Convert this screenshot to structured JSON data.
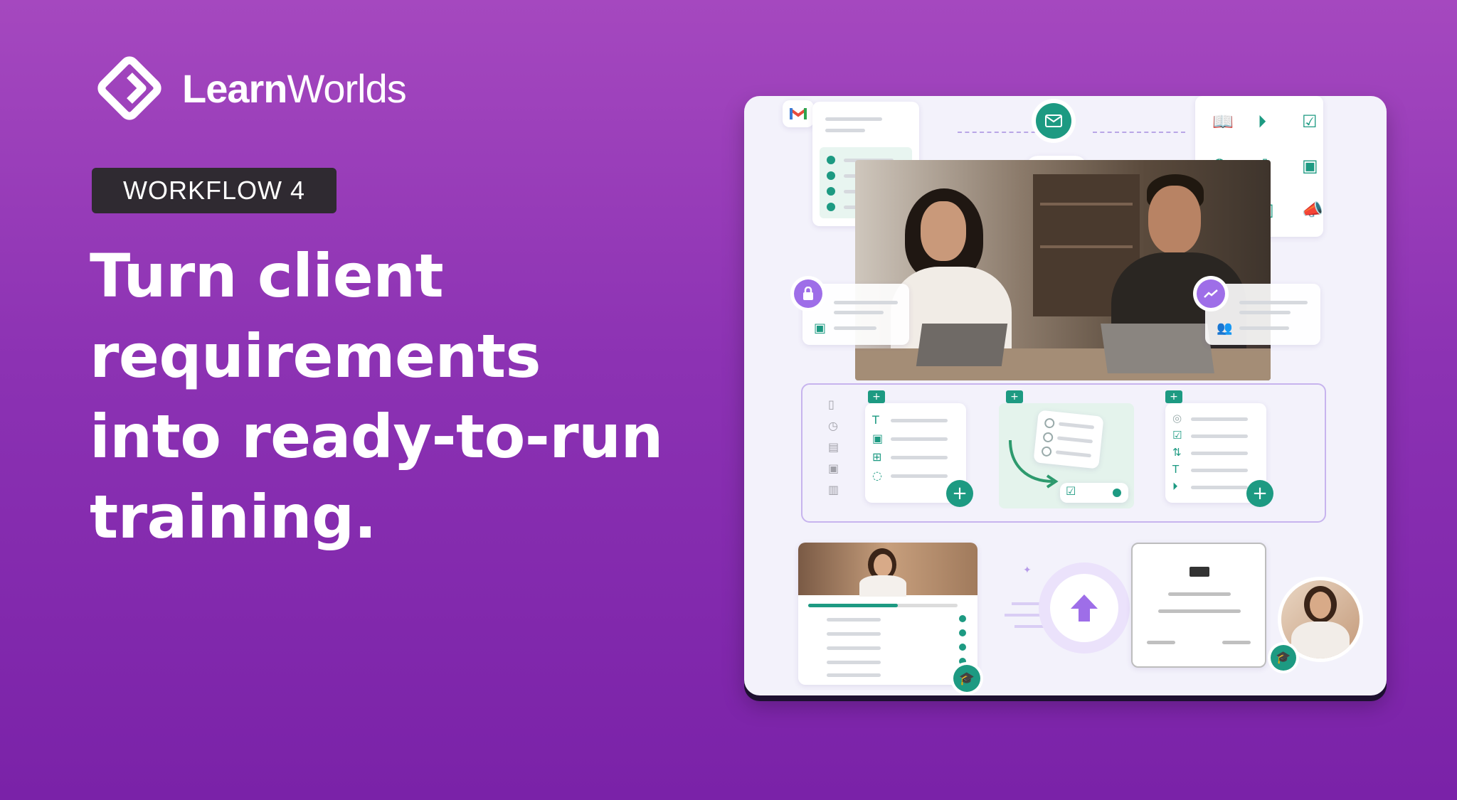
{
  "brand": {
    "name_bold": "Learn",
    "name_light": "Worlds"
  },
  "badge": "WORKFLOW 4",
  "headline": "Turn client requirements into ready-to-run training.",
  "colors": {
    "bg_top": "#a548bf",
    "bg_bottom": "#7a22a8",
    "teal": "#1d9a82",
    "purple": "#9e6ee8",
    "badge_bg": "#2f2a31"
  },
  "illustration": {
    "top_icons": [
      "gmail-icon",
      "email-icon",
      "phone-icon"
    ],
    "asset_grid_icons": [
      "book-icon",
      "play-icon",
      "clipboard-check-icon",
      "award-icon",
      "download-file-icon",
      "image-icon",
      "document-icon",
      "bar-chart-icon",
      "megaphone-icon"
    ],
    "side_icons": [
      "lock-icon",
      "trend-icon",
      "image-icon",
      "users-icon"
    ],
    "builder_left_icons": [
      "book-icon",
      "play-icon",
      "file-icon",
      "image-icon",
      "bar-chart-icon"
    ],
    "builder_col1_icons": [
      "T",
      "image",
      "plus-square",
      "chat"
    ],
    "builder_col3_icons": [
      "target",
      "check-square",
      "sort",
      "T",
      "play"
    ],
    "bottom_icons": [
      "upload-arrow-icon",
      "graduation-cap-icon",
      "certificate-icon"
    ]
  }
}
